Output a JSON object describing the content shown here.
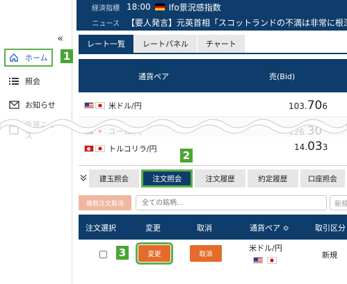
{
  "ticker": {
    "row1": {
      "label": "経済指標",
      "time": "18:00",
      "flag": "flag-de-icon",
      "text": "Ifo景況感指数"
    },
    "row2": {
      "label": "ニュース",
      "text": "【要人発言】元英首相「スコットランドの不満は非常に根深く"
    }
  },
  "sidebar": {
    "collapse": "«",
    "items": [
      {
        "label": "ホーム",
        "icon": "home-icon"
      },
      {
        "label": "照会",
        "icon": "list-icon"
      },
      {
        "label": "お知らせ",
        "icon": "mail-icon"
      },
      {
        "label": "外貨ニュース",
        "icon": "news-icon"
      }
    ]
  },
  "callouts": [
    "1",
    "2",
    "3"
  ],
  "top_tabs": [
    "レート一覧",
    "レートパネル",
    "チャート"
  ],
  "rate_table": {
    "headers": {
      "pair": "通貨ペア",
      "bid": "売(Bid)"
    },
    "rows": [
      {
        "pair": "米ドル/円",
        "flags": [
          "flag-us-icon",
          "flag-jp-icon"
        ],
        "bid_main": "103.",
        "bid_big": "70",
        "bid_small": "6"
      },
      {
        "pair": "ユーロ/円",
        "flags": [
          "flag-eu-icon",
          "flag-jp-icon"
        ],
        "bid_main": "126.",
        "bid_big": "30",
        "bid_small": ""
      },
      {
        "pair": "トルコリラ/円",
        "flags": [
          "flag-tr-icon",
          "flag-jp-icon"
        ],
        "bid_main": "14.",
        "bid_big": "03",
        "bid_small": "3"
      }
    ]
  },
  "bottom_tabs": [
    "建玉照会",
    "注文照会",
    "注文履歴",
    "約定履歴",
    "口座照会"
  ],
  "filters": {
    "bulk_cancel": "複数注文取消",
    "search_placeholder": "全ての銘柄...",
    "new_order": "新規"
  },
  "orders": {
    "headers": [
      "注文選択",
      "変更",
      "取消",
      "通貨ペア ≎",
      "取引区分"
    ],
    "rows": [
      {
        "change": "変更",
        "cancel": "取消",
        "pair": "米ドル/円",
        "type": "新規"
      }
    ]
  },
  "colors": {
    "navy": "#0f3d6b",
    "accent_green": "#5bb04a",
    "orange": "#e46b2a"
  }
}
